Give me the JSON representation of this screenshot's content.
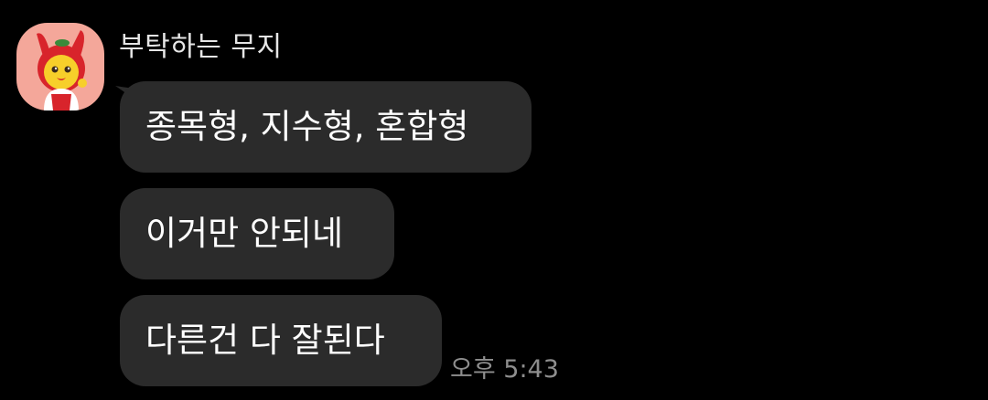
{
  "chat": {
    "sender": {
      "name": "부탁하는 무지",
      "avatar_icon": "muzi-character-avatar-icon",
      "avatar_bg": "#f4a79a"
    },
    "messages": [
      {
        "text": "종목형, 지수형, 혼합형"
      },
      {
        "text": "이거만 안되네"
      },
      {
        "text": "다른건 다 잘된다"
      }
    ],
    "timestamp": "오후 5:43"
  },
  "colors": {
    "background": "#000000",
    "bubble": "#2b2b2b",
    "text": "#ffffff",
    "name_text": "#e6e6e6",
    "timestamp_text": "#8e8e8e"
  }
}
